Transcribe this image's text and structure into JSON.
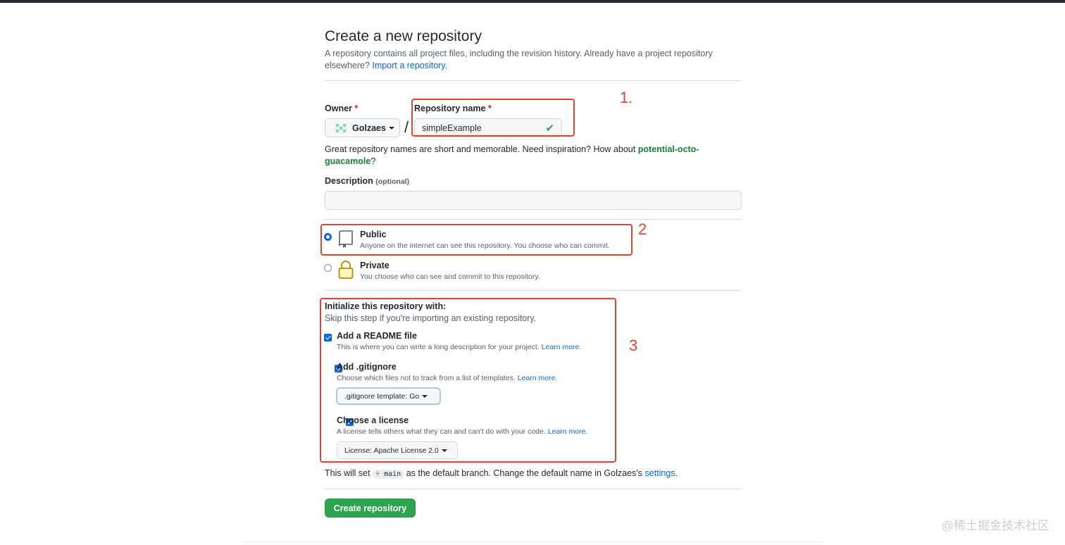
{
  "header": {
    "title": "Create a new repository",
    "subtitle": "A repository contains all project files, including the revision history. Already have a project repository elsewhere?",
    "import_link": "Import a repository."
  },
  "owner": {
    "label": "Owner",
    "required_mark": "*",
    "value": "Golzaes",
    "avatar_icon": "identicon"
  },
  "separator": "/",
  "repo_name": {
    "label": "Repository name",
    "required_mark": "*",
    "value": "simpleExample",
    "status_icon": "check-icon"
  },
  "name_hint": {
    "text": "Great repository names are short and memorable. Need inspiration? How about",
    "suggestion": "potential-octo-guacamole",
    "suffix": "?"
  },
  "description": {
    "label": "Description",
    "optional": "(optional)",
    "value": ""
  },
  "visibility": {
    "public": {
      "title": "Public",
      "desc": "Anyone on the internet can see this repository. You choose who can commit.",
      "icon": "repo-icon",
      "selected": true
    },
    "private": {
      "title": "Private",
      "desc": "You choose who can see and commit to this repository.",
      "icon": "lock-icon",
      "selected": false
    }
  },
  "init": {
    "title": "Initialize this repository with:",
    "subtitle": "Skip this step if you're importing an existing repository.",
    "readme": {
      "title": "Add a README file",
      "desc": "This is where you can write a long description for your project.",
      "link": "Learn more.",
      "checked": true
    },
    "gitignore": {
      "title": "Add .gitignore",
      "desc": "Choose which files not to track from a list of templates.",
      "link": "Learn more.",
      "checked": true,
      "dropdown": ".gitignore template: Go"
    },
    "license": {
      "title": "Choose a license",
      "desc": "A license tells others what they can and can't do with your code.",
      "link": "Learn more.",
      "checked": true,
      "dropdown": "License: Apache License 2.0"
    }
  },
  "branch_note": {
    "prefix": "This will set",
    "branch": "main",
    "middle": "as the default branch. Change the default name in Golzaes's",
    "link": "settings",
    "suffix": "."
  },
  "create_button": "Create repository",
  "annotations": {
    "one": "1.",
    "two": "2",
    "three": "3"
  },
  "watermark": "@稀土掘金技术社区",
  "colors": {
    "accent": "#0969da",
    "success": "#2da44e",
    "annotation_red": "#e0432f",
    "suggestion_green": "#1a7f37"
  }
}
